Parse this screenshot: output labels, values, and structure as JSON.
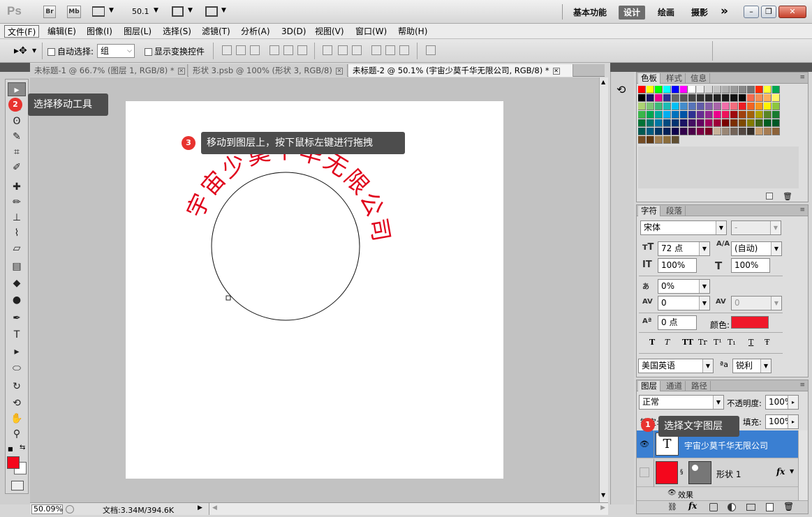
{
  "app": {
    "logo": "Ps",
    "buttons": [
      "Br",
      "Mb"
    ],
    "zoom": "50.1",
    "workspaces": [
      "基本功能",
      "设计",
      "绘画",
      "摄影"
    ],
    "active_workspace": "设计",
    "more": "»",
    "window_controls": [
      "–",
      "❐",
      "✕"
    ]
  },
  "menu": [
    "文件(F)",
    "编辑(E)",
    "图像(I)",
    "图层(L)",
    "选择(S)",
    "滤镜(T)",
    "分析(A)",
    "3D(D)",
    "视图(V)",
    "窗口(W)",
    "帮助(H)"
  ],
  "options": {
    "auto_select_label": "自动选择:",
    "auto_select_value": "组",
    "show_transform_label": "显示变换控件"
  },
  "doc_tabs": [
    {
      "label": "未标题-1 @ 66.7% (图层 1, RGB/8) *"
    },
    {
      "label": "形状 3.psb @ 100% (形状 3, RGB/8)"
    },
    {
      "label": "未标题-2 @ 50.1% (宇宙少莫千华无限公司, RGB/8) *"
    }
  ],
  "canvas": {
    "arc_text": "宇宙少莫千华无限公司",
    "colors": {
      "text": "#e0001b",
      "circle": "#111111"
    }
  },
  "tips": [
    {
      "num": "1",
      "text": "选择文字图层"
    },
    {
      "num": "2",
      "text": "选择移动工具"
    },
    {
      "num": "3",
      "text": "移动到图层上，按下鼠标左键进行拖拽"
    }
  ],
  "status": {
    "zoom": "50.09%",
    "doc": "文档:3.34M/394.6K"
  },
  "swatches_panel": {
    "tabs": [
      "色板",
      "样式",
      "信息"
    ]
  },
  "character_panel": {
    "tabs": [
      "字符",
      "段落"
    ],
    "font_family": "宋体",
    "font_style": "-",
    "size": "72 点",
    "leading": "(自动)",
    "vscale": "100%",
    "hscale": "100%",
    "tracking_pct": "0%",
    "kerning": "0",
    "tracking": "0",
    "baseline": "0 点",
    "color_label": "颜色:",
    "color": "#f0182a",
    "language": "美国英语",
    "aa_label": "a",
    "antialias": "锐利",
    "style_buttons": [
      "T",
      "T",
      "TT",
      "Tr",
      "T¹",
      "T₁",
      "T",
      "Ŧ"
    ]
  },
  "layers_panel": {
    "tabs": [
      "图层",
      "通道",
      "路径"
    ],
    "blend": "正常",
    "opacity_label": "不透明度:",
    "opacity": "100%",
    "lock_label": "锁定:",
    "fill_label": "填充:",
    "fill": "100%",
    "layers": [
      {
        "name": "宇宙少莫千华无限公司",
        "type": "T",
        "selected": true
      },
      {
        "name": "形状 1",
        "fx": "fx",
        "selected": false
      }
    ],
    "effects_label": "效果",
    "footer_icons": [
      "link-icon",
      "fx-icon",
      "mask-icon",
      "adjust-icon",
      "group-icon",
      "new-layer-icon",
      "trash-icon"
    ]
  }
}
